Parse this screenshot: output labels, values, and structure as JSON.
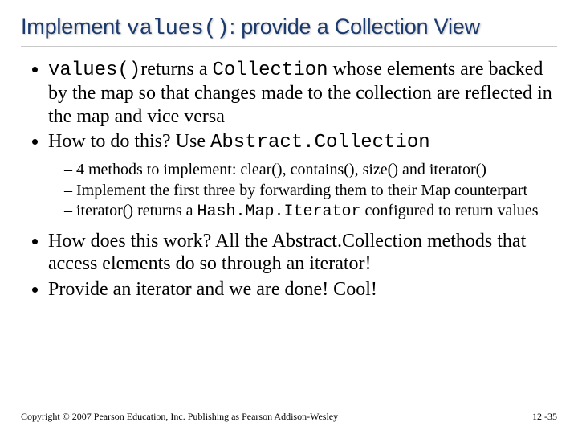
{
  "title": {
    "pre": "Implement ",
    "code": "values()",
    "post": ": provide a Collection View"
  },
  "b1": {
    "code1": "values()",
    "t1": "returns a ",
    "code2": "Collection",
    "t2": " whose elements are backed by the map so that changes made to the collection are reflected in the map and vice versa"
  },
  "b2": {
    "t1": "How to do this? Use ",
    "code1": "Abstract.Collection"
  },
  "sub": {
    "s1": "4 methods to implement: clear(), contains(), size() and iterator()",
    "s2": "Implement the first three by forwarding them to their Map counterpart",
    "s3a": "iterator() returns a ",
    "s3code": "Hash.Map.Iterator",
    "s3b": " configured to return values"
  },
  "b3": "How does this work? All the Abstract.Collection methods that access elements do so through an iterator!",
  "b4": "Provide an iterator and we are done! Cool!",
  "footer": "Copyright © 2007 Pearson Education, Inc. Publishing as Pearson Addison-Wesley",
  "pagenum": "12 -35"
}
